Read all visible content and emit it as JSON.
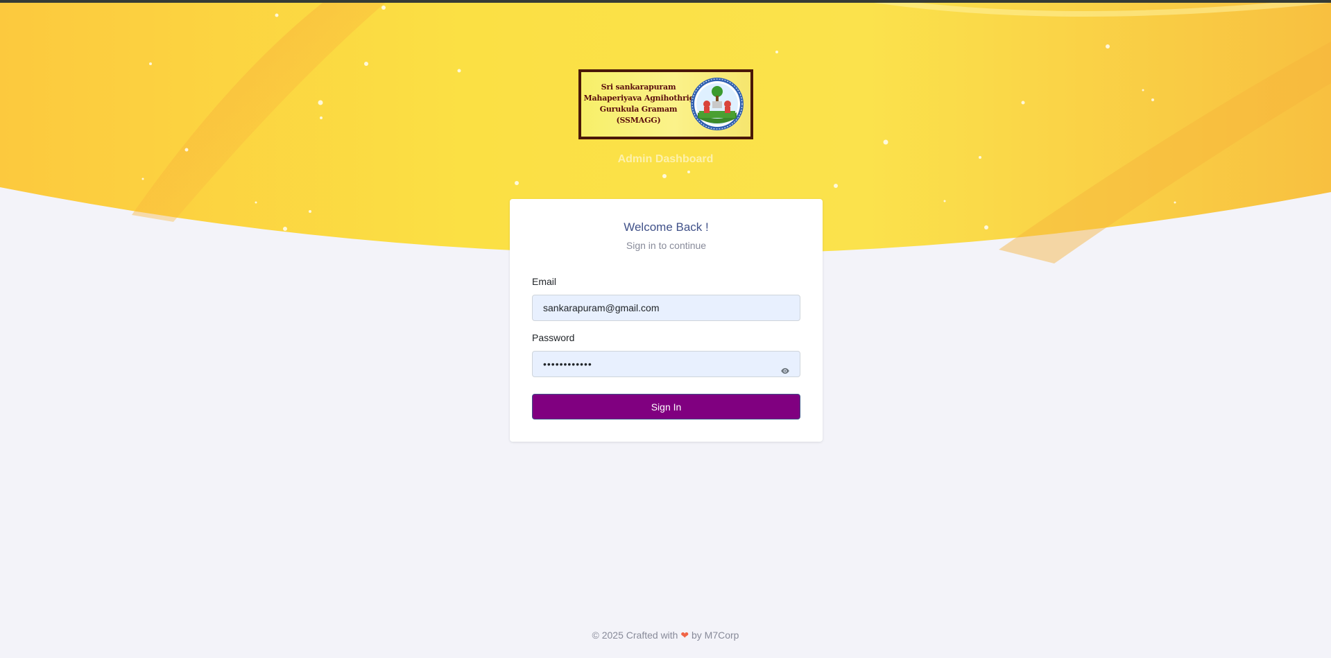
{
  "brand": {
    "logo_lines": [
      "Sri sankarapuram",
      "Mahaperiyava Agnihothrigal",
      "Gurukula Gramam",
      "(SSMAGG)"
    ],
    "subtitle": "Admin Dashboard"
  },
  "card": {
    "title": "Welcome Back !",
    "subtitle": "Sign in to continue",
    "email_label": "Email",
    "email_value": "sankarapuram@gmail.com",
    "password_label": "Password",
    "password_value": "••••••••••••",
    "sign_in_label": "Sign In"
  },
  "footer": {
    "prefix": "© 2025 Crafted with",
    "heart": "❤",
    "suffix": "by M7Corp"
  },
  "colors": {
    "accent_button": "#800080",
    "title": "#405189",
    "hero": "#fbd64a",
    "input_bg": "#e8f0fe"
  },
  "icons": {
    "password_toggle": "eye-icon",
    "footer_heart": "heart-icon"
  }
}
